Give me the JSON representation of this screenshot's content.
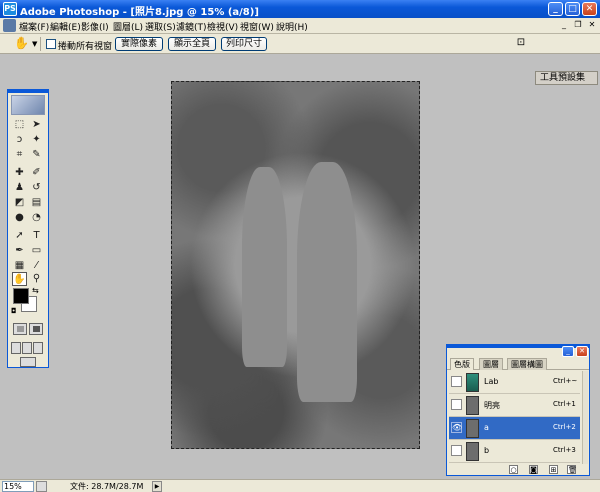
{
  "window": {
    "title": "Adobe Photoshop - [照片8.jpg @ 15% (a/8)]",
    "app_icon": "PS",
    "min_icon": "_",
    "max_icon": "□",
    "close_icon": "✕"
  },
  "menubar": {
    "items": [
      {
        "label": "檔案(F)"
      },
      {
        "label": "編輯(E)"
      },
      {
        "label": "影像(I)"
      },
      {
        "label": "圖層(L)"
      },
      {
        "label": "選取(S)"
      },
      {
        "label": "濾鏡(T)"
      },
      {
        "label": "檢視(V)"
      },
      {
        "label": "視窗(W)"
      },
      {
        "label": "說明(H)"
      }
    ],
    "mdi_min": "_",
    "mdi_restore": "❐",
    "mdi_close": "✕"
  },
  "options": {
    "hand_glyph": "✋",
    "dropdown_glyph": "▼",
    "scroll_all_label": "捲動所有視窗",
    "actual_pixels": "實際像素",
    "fit_on_screen": "顯示全頁",
    "print_size": "列印尺寸",
    "palette_well": "工具預設集",
    "right_icon_glyph": "⊡"
  },
  "toolbox": {
    "tools": [
      {
        "icon": "marquee-icon",
        "glyph": "⬚"
      },
      {
        "icon": "move-icon",
        "glyph": "➤"
      },
      {
        "icon": "lasso-icon",
        "glyph": "ↄ"
      },
      {
        "icon": "magic-wand-icon",
        "glyph": "✦"
      },
      {
        "icon": "crop-icon",
        "glyph": "⌗"
      },
      {
        "icon": "slice-icon",
        "glyph": "✎"
      },
      {
        "icon": "healing-brush-icon",
        "glyph": "✚"
      },
      {
        "icon": "brush-icon",
        "glyph": "✐"
      },
      {
        "icon": "clone-stamp-icon",
        "glyph": "♟"
      },
      {
        "icon": "history-brush-icon",
        "glyph": "↺"
      },
      {
        "icon": "eraser-icon",
        "glyph": "◩"
      },
      {
        "icon": "gradient-icon",
        "glyph": "▤"
      },
      {
        "icon": "blur-icon",
        "glyph": "●"
      },
      {
        "icon": "dodge-icon",
        "glyph": "◔"
      },
      {
        "icon": "path-select-icon",
        "glyph": "➚"
      },
      {
        "icon": "type-icon",
        "glyph": "T"
      },
      {
        "icon": "pen-icon",
        "glyph": "✒"
      },
      {
        "icon": "shape-icon",
        "glyph": "▭"
      },
      {
        "icon": "notes-icon",
        "glyph": "▦"
      },
      {
        "icon": "eyedropper-icon",
        "glyph": "⁄"
      },
      {
        "icon": "hand-icon",
        "glyph": "✋"
      },
      {
        "icon": "zoom-icon",
        "glyph": "⚲"
      }
    ],
    "swap_glyph": "⇆",
    "reset_glyph": "◘"
  },
  "layers_panel": {
    "tabs": [
      {
        "label": "色版"
      },
      {
        "label": "圖層"
      },
      {
        "label": "圖層構圖"
      }
    ],
    "menu_glyph": "▸",
    "channels": [
      {
        "name": "Lab",
        "shortcut": "Ctrl+~",
        "visible_glyph": "",
        "thumb": "color"
      },
      {
        "name": "明亮",
        "shortcut": "Ctrl+1",
        "visible_glyph": "",
        "thumb": "gray"
      },
      {
        "name": "a",
        "shortcut": "Ctrl+2",
        "visible_glyph": "👁",
        "thumb": "gray"
      },
      {
        "name": "b",
        "shortcut": "Ctrl+3",
        "visible_glyph": "",
        "thumb": "gray"
      }
    ],
    "footer_icons": [
      {
        "name": "load-selection-icon",
        "glyph": "○"
      },
      {
        "name": "save-selection-icon",
        "glyph": "◙"
      },
      {
        "name": "new-channel-icon",
        "glyph": "⊞"
      },
      {
        "name": "delete-channel-icon",
        "glyph": "🗑"
      }
    ]
  },
  "statusbar": {
    "zoom": "15%",
    "file_info": "文件: 28.7M/28.7M",
    "arrow_glyph": "▶"
  }
}
